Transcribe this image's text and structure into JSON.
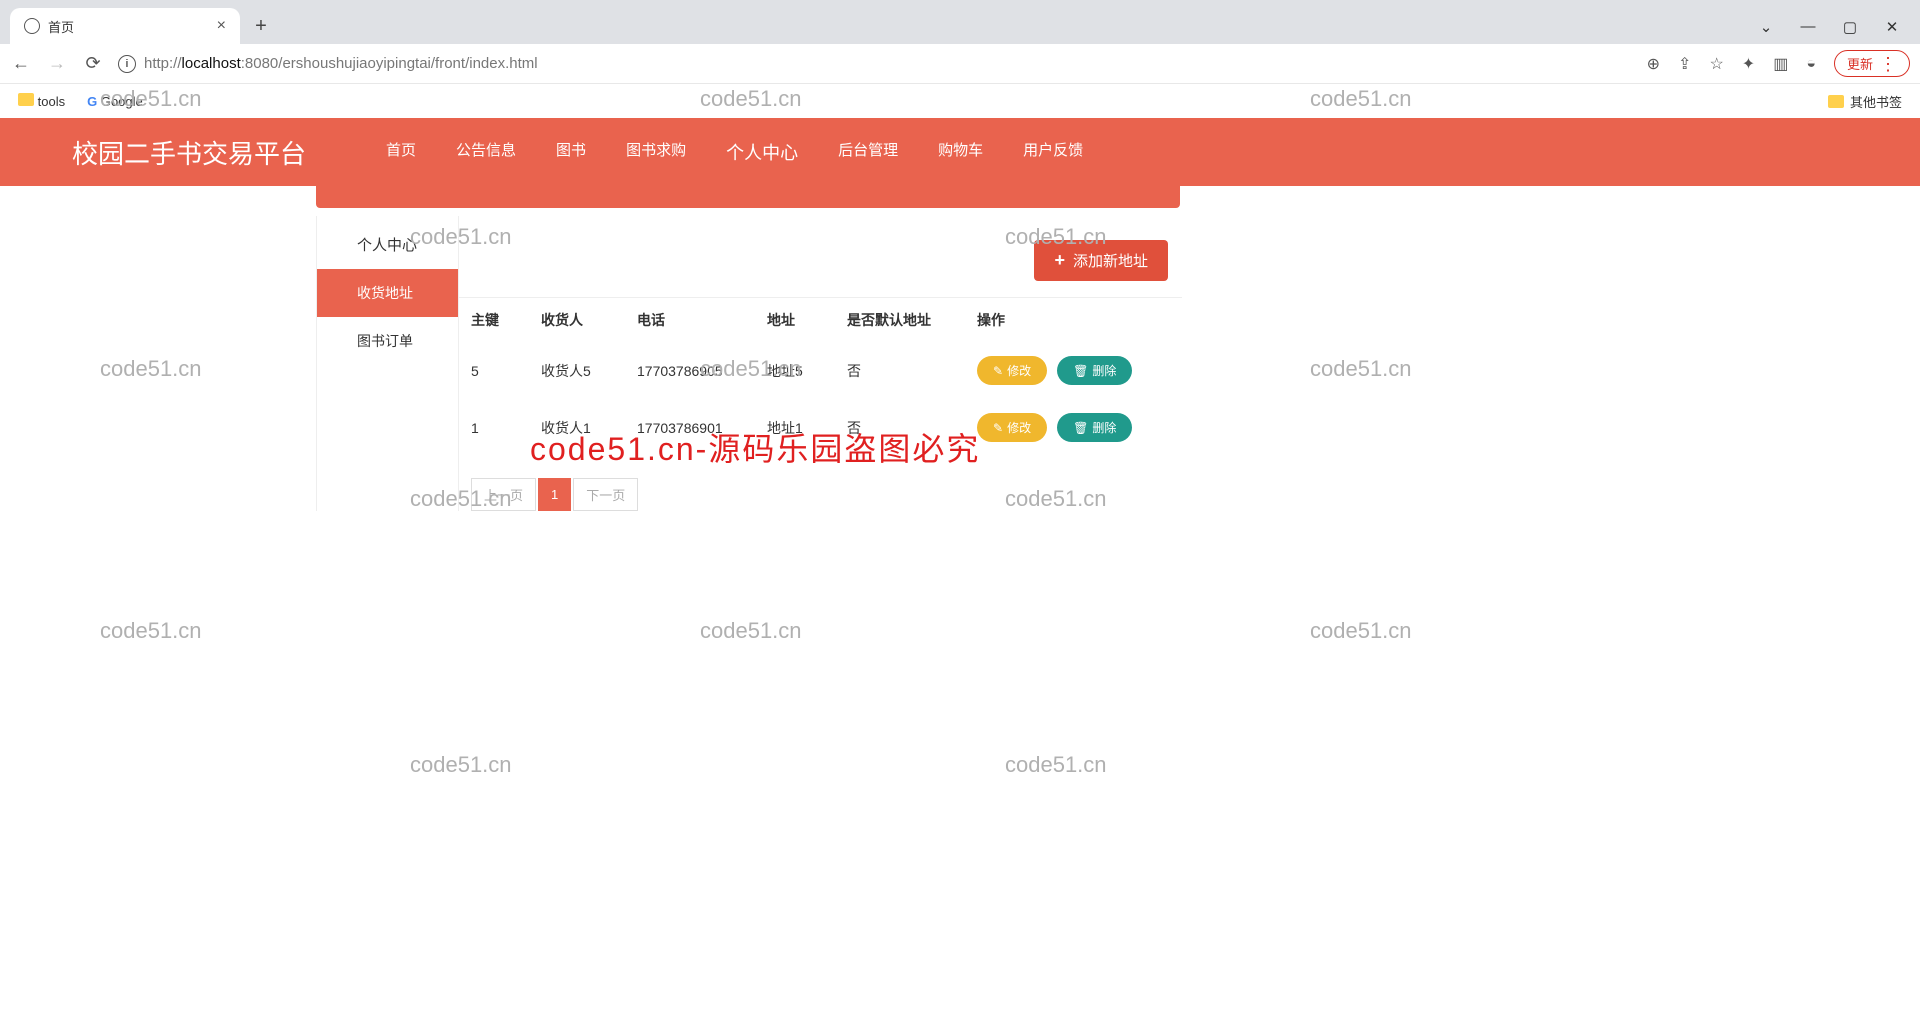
{
  "browser": {
    "tab_title": "首页",
    "url_prefix": "http://",
    "url_host": "localhost",
    "url_port": ":8080",
    "url_path": "/ershoushujiaoyipingtai/front/index.html",
    "update_label": "更新",
    "bookmarks": {
      "tools": "tools",
      "google": "Google",
      "other": "其他书签"
    }
  },
  "site": {
    "title": "校园二手书交易平台",
    "nav": [
      "首页",
      "公告信息",
      "图书",
      "图书求购",
      "个人中心",
      "后台管理",
      "购物车",
      "用户反馈"
    ],
    "nav_active_index": 4
  },
  "sidebar": {
    "title": "个人中心",
    "items": [
      {
        "label": "收货地址",
        "active": true
      },
      {
        "label": "图书订单",
        "active": false
      }
    ]
  },
  "toolbar": {
    "add_label": "添加新地址"
  },
  "table": {
    "headers": {
      "id": "主键",
      "name": "收货人",
      "phone": "电话",
      "addr": "地址",
      "default": "是否默认地址",
      "op": "操作"
    },
    "rows": [
      {
        "id": "5",
        "name": "收货人5",
        "phone": "17703786905",
        "addr": "地址5",
        "default": "否"
      },
      {
        "id": "1",
        "name": "收货人1",
        "phone": "17703786901",
        "addr": "地址1",
        "default": "否"
      }
    ],
    "edit_label": "修改",
    "delete_label": "删除"
  },
  "pager": {
    "prev": "上一页",
    "page": "1",
    "next": "下一页"
  },
  "watermark": {
    "grey": "code51.cn",
    "red": "code51.cn-源码乐园盗图必究"
  }
}
